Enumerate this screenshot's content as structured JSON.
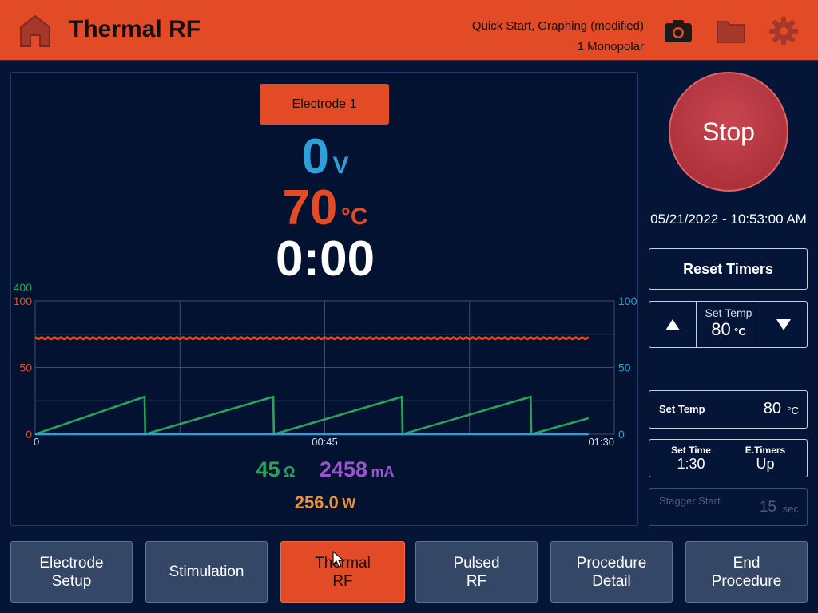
{
  "header": {
    "title": "Thermal RF",
    "preset_line1": "Quick Start, Graphing (modified)",
    "preset_line2": "1 Monopolar",
    "icons": [
      "home-icon",
      "camera-icon",
      "folder-icon",
      "gear-icon"
    ]
  },
  "colors": {
    "accent": "#e34a26",
    "background": "#041537",
    "voltage": "#2e9fd9",
    "impedance": "#2aa35a",
    "current": "#9a55d0",
    "power": "#e8923a",
    "stop": "#b13440"
  },
  "main": {
    "electrode_label": "Electrode 1",
    "voltage": {
      "value": "0",
      "unit": "V"
    },
    "temperature": {
      "value": "70",
      "unit": "°C"
    },
    "elapsed": "0:00",
    "impedance": {
      "value": "45",
      "unit": "Ω"
    },
    "current": {
      "value": "2458",
      "unit": "mA"
    },
    "power": {
      "value": "256.0",
      "unit": "W"
    }
  },
  "chart_data": {
    "type": "line",
    "x_tick_labels": [
      "0",
      "00:45",
      "01:30"
    ],
    "xlim": [
      0,
      90
    ],
    "y_left_top_label": "400",
    "y_left_ticks": [
      "0",
      "50",
      "100"
    ],
    "y_right_ticks": [
      "0",
      "50",
      "100"
    ],
    "ylim": [
      0,
      100
    ],
    "grid": true,
    "series": [
      {
        "color": "#e34a26",
        "x": [
          0,
          90
        ],
        "y": [
          72,
          72
        ]
      },
      {
        "color": "#2aa35a",
        "x": [
          0,
          17,
          17.1,
          37,
          37.1,
          57,
          57.1,
          77,
          77.1,
          86
        ],
        "y": [
          0,
          28,
          0,
          28,
          0,
          28,
          0,
          28,
          0,
          12
        ]
      },
      {
        "color": "#2e9fd9",
        "x": [
          0,
          86
        ],
        "y": [
          0,
          0
        ]
      }
    ]
  },
  "controls": {
    "stop_label": "Stop",
    "datetime": "05/21/2022 - 10:53:00 AM",
    "reset_label": "Reset Timers",
    "stepper": {
      "label": "Set Temp",
      "value": "80",
      "unit": "°C"
    },
    "set_temp": {
      "label": "Set Temp",
      "value": "80",
      "unit": "°C"
    },
    "set_time": {
      "label": "Set Time",
      "value": "1:30"
    },
    "e_timers": {
      "label": "E.Timers",
      "value": "Up"
    },
    "stagger": {
      "label": "Stagger Start",
      "value": "15",
      "unit": "sec"
    }
  },
  "nav": [
    {
      "line1": "Electrode",
      "line2": "Setup",
      "active": false
    },
    {
      "line1": "Stimulation",
      "line2": "",
      "active": false
    },
    {
      "line1": "Thermal",
      "line2": "RF",
      "active": true
    },
    {
      "line1": "Pulsed",
      "line2": "RF",
      "active": false
    },
    {
      "line1": "Procedure",
      "line2": "Detail",
      "active": false
    },
    {
      "line1": "End",
      "line2": "Procedure",
      "active": false
    }
  ]
}
